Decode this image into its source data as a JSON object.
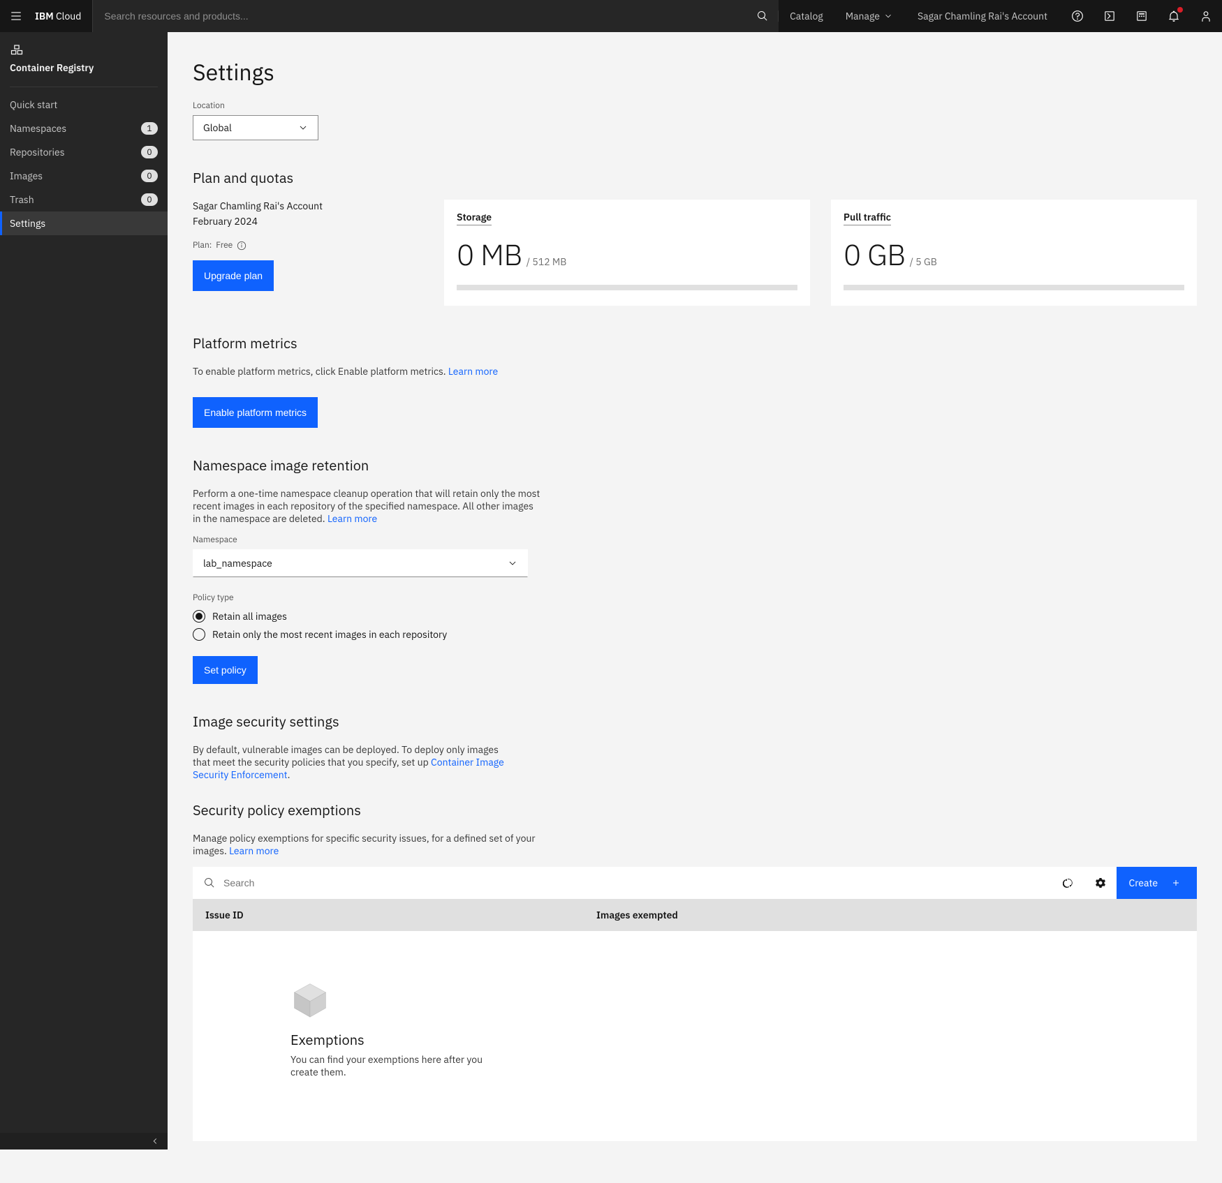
{
  "brand": {
    "first": "IBM",
    "second": "Cloud"
  },
  "search_placeholder": "Search resources and products...",
  "topnav": {
    "catalog": "Catalog",
    "manage": "Manage",
    "account": "Sagar Chamling Rai's Account"
  },
  "sidebar": {
    "title": "Container Registry",
    "items": [
      {
        "label": "Quick start",
        "badge": null,
        "active": false
      },
      {
        "label": "Namespaces",
        "badge": "1",
        "active": false
      },
      {
        "label": "Repositories",
        "badge": "0",
        "active": false
      },
      {
        "label": "Images",
        "badge": "0",
        "active": false
      },
      {
        "label": "Trash",
        "badge": "0",
        "active": false
      },
      {
        "label": "Settings",
        "badge": null,
        "active": true
      }
    ]
  },
  "page": {
    "title": "Settings",
    "location_label": "Location",
    "location_value": "Global"
  },
  "plan": {
    "heading": "Plan and quotas",
    "account": "Sagar Chamling Rai's Account",
    "month": "February 2024",
    "plan_line_prefix": "Plan: ",
    "plan_line_value": "Free",
    "upgrade_btn": "Upgrade plan",
    "storage": {
      "title": "Storage",
      "value": "0 MB",
      "cap": "/ 512 MB"
    },
    "pull": {
      "title": "Pull traffic",
      "value": "0 GB",
      "cap": "/ 5 GB"
    }
  },
  "metrics": {
    "heading": "Platform metrics",
    "body": "To enable platform metrics, click Enable platform metrics.",
    "learn_more": "Learn more",
    "enable_btn": "Enable platform metrics"
  },
  "retention": {
    "heading": "Namespace image retention",
    "body": "Perform a one-time namespace cleanup operation that will retain only the most recent images in each repository of the specified namespace. All other images in the namespace are deleted.",
    "learn_more": "Learn more",
    "ns_label": "Namespace",
    "ns_value": "lab_namespace",
    "policy_type_label": "Policy type",
    "opt_all": "Retain all images",
    "opt_recent": "Retain only the most recent images in each repository",
    "set_policy_btn": "Set policy"
  },
  "security": {
    "heading": "Image security settings",
    "body_a": "By default, vulnerable images can be deployed. To deploy only images that meet the security policies that you specify, set up",
    "link_text": "Container Image Security Enforcement",
    "body_b": "."
  },
  "exemptions": {
    "heading": "Security policy exemptions",
    "body": "Manage policy exemptions for specific security issues, for a defined set of your images.",
    "learn_more": "Learn more",
    "search_placeholder": "Search",
    "create_btn": "Create",
    "col_issue": "Issue ID",
    "col_images": "Images exempted",
    "empty_title": "Exemptions",
    "empty_body": "You can find your exemptions here after you create them."
  }
}
